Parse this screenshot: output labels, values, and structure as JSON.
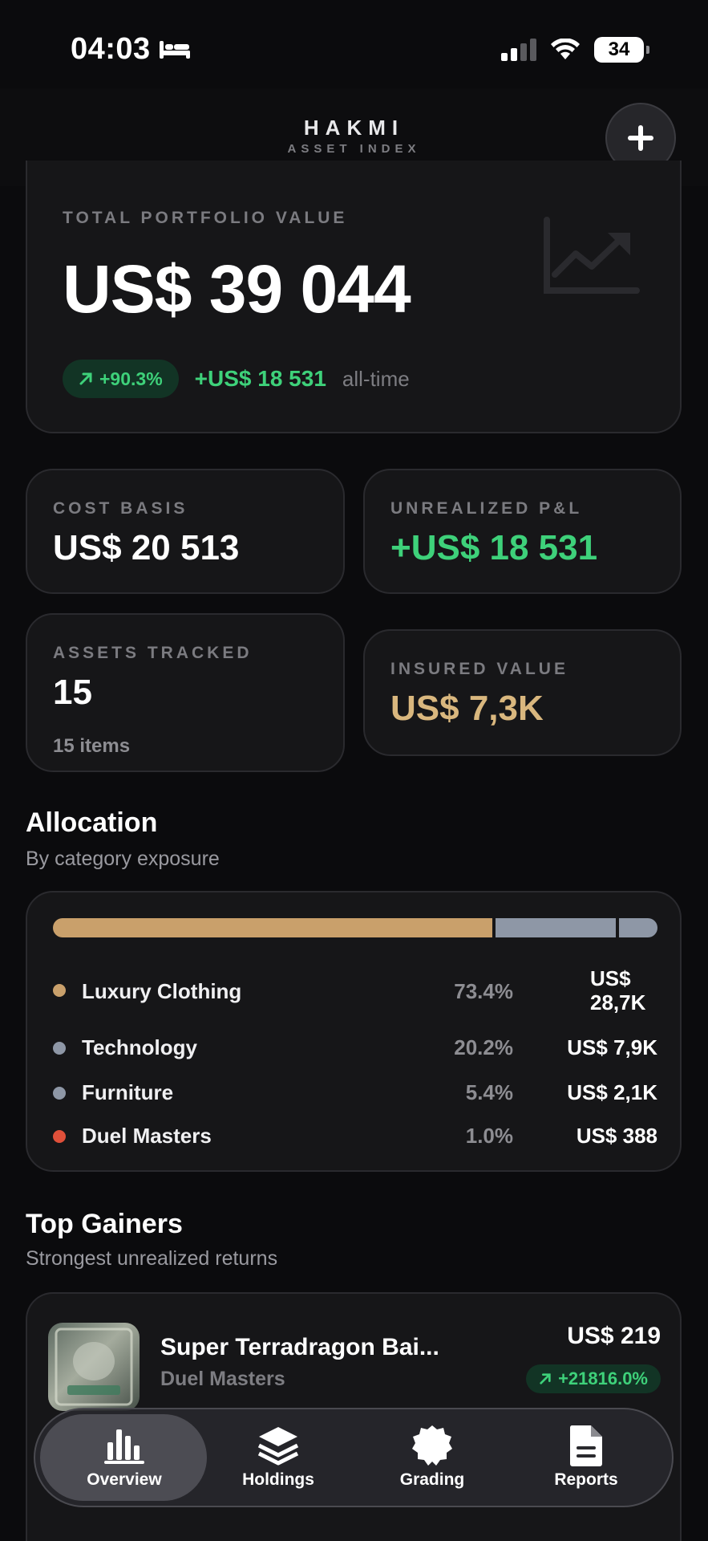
{
  "status_bar": {
    "time": "04:03",
    "battery": "34"
  },
  "header": {
    "title": "HAKMI",
    "subtitle": "ASSET INDEX"
  },
  "portfolio": {
    "label": "TOTAL PORTFOLIO VALUE",
    "value": "US$ 39 044",
    "change_pct": "+90.3%",
    "change_amount": "+US$ 18 531",
    "period": "all-time"
  },
  "stats": {
    "cost_basis": {
      "label": "COST BASIS",
      "value": "US$ 20 513"
    },
    "unrealized": {
      "label": "UNREALIZED P&L",
      "value": "+US$ 18 531"
    },
    "assets": {
      "label": "ASSETS TRACKED",
      "value": "15",
      "sub": "15 items"
    },
    "insured": {
      "label": "INSURED VALUE",
      "value": "US$ 7,3K"
    }
  },
  "allocation": {
    "title": "Allocation",
    "subtitle": "By category exposure",
    "items": [
      {
        "name": "Luxury Clothing",
        "pct": "73.4%",
        "value": "US$ 28,7K",
        "share": 0.734,
        "color": "#c9a06b"
      },
      {
        "name": "Technology",
        "pct": "20.2%",
        "value": "US$ 7,9K",
        "share": 0.202,
        "color": "#8e97a6"
      },
      {
        "name": "Furniture",
        "pct": "5.4%",
        "value": "US$ 2,1K",
        "share": 0.054,
        "color": "#8e97a6"
      },
      {
        "name": "Duel Masters",
        "pct": "1.0%",
        "value": "US$ 388",
        "share": 0.01,
        "color": "#e0503a"
      }
    ]
  },
  "top_gainers": {
    "title": "Top Gainers",
    "subtitle": "Strongest unrealized returns",
    "items": [
      {
        "name": "Super Terradragon Bai...",
        "category": "Duel Masters",
        "value": "US$ 219",
        "change": "+21816.0%"
      }
    ]
  },
  "tabs": [
    {
      "label": "Overview",
      "icon": "bar-chart-icon",
      "active": true
    },
    {
      "label": "Holdings",
      "icon": "layers-icon",
      "active": false
    },
    {
      "label": "Grading",
      "icon": "badge-icon",
      "active": false
    },
    {
      "label": "Reports",
      "icon": "document-icon",
      "active": false
    }
  ],
  "colors": {
    "positive": "#3ed17a",
    "gold": "#d9b77e",
    "background": "#0b0b0d"
  }
}
